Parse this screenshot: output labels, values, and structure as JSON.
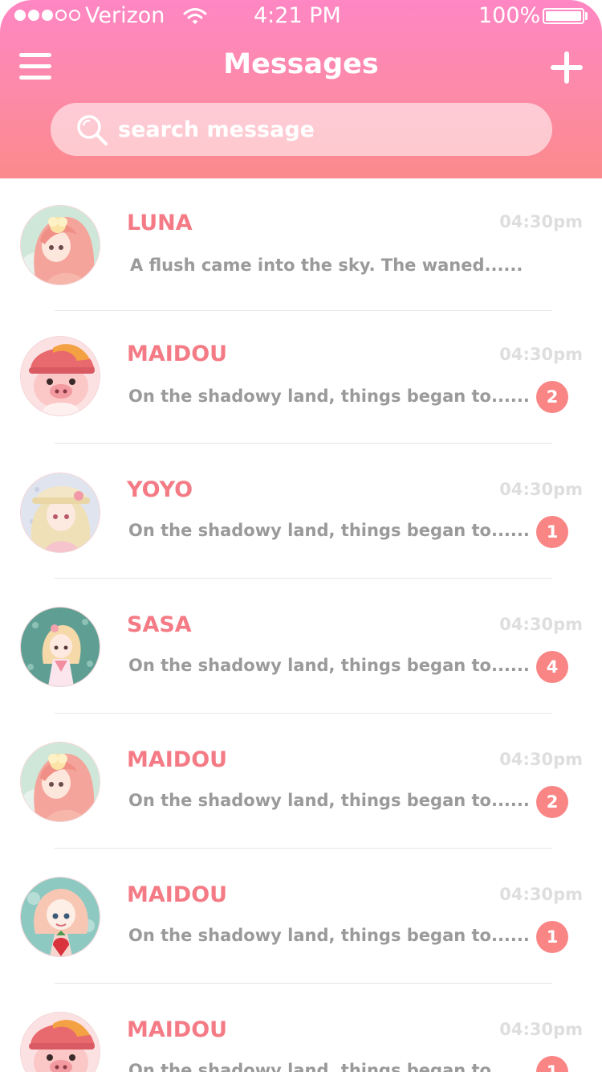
{
  "colors": {
    "header_top": "#fe87c4",
    "header_bottom": "#fb8a8c",
    "name": "#f47b85",
    "preview": "#9a9a9a",
    "time": "#dedede",
    "badge": "#f98585"
  },
  "status_bar": {
    "carrier": "Verizon",
    "time": "4:21 PM",
    "battery": "100%",
    "battery_level": 1.0,
    "signal_bars_filled": 3,
    "signal_bars_total": 5
  },
  "header": {
    "title": "Messages",
    "menu_icon": "hamburger-menu-icon",
    "add_icon": "plus-icon"
  },
  "search": {
    "placeholder": "search message",
    "value": "",
    "icon": "search-icon"
  },
  "messages": [
    {
      "name": "LUNA",
      "preview": "A flush came into the sky. The waned......",
      "time": "04:30pm",
      "unread": "",
      "avatar": "avatar-girl-pink-hair"
    },
    {
      "name": "MAIDOU",
      "preview": "On the shadowy land, things began to......",
      "time": "04:30pm",
      "unread": "2",
      "avatar": "avatar-pig-cap"
    },
    {
      "name": "YOYO",
      "preview": "On the shadowy land, things began to......",
      "time": "04:30pm",
      "unread": "1",
      "avatar": "avatar-girl-blonde-hat"
    },
    {
      "name": "SASA",
      "preview": "On the shadowy land, things began to......",
      "time": "04:30pm",
      "unread": "4",
      "avatar": "avatar-girl-teal-background"
    },
    {
      "name": "MAIDOU",
      "preview": "On the shadowy land, things began to......",
      "time": "04:30pm",
      "unread": "2",
      "avatar": "avatar-girl-pink-hair"
    },
    {
      "name": "MAIDOU",
      "preview": "On the shadowy land, things began to......",
      "time": "04:30pm",
      "unread": "1",
      "avatar": "avatar-girl-strawberry"
    },
    {
      "name": "MAIDOU",
      "preview": "On the shadowy land, things began to......",
      "time": "04:30pm",
      "unread": "1",
      "avatar": "avatar-pig-cap"
    }
  ]
}
